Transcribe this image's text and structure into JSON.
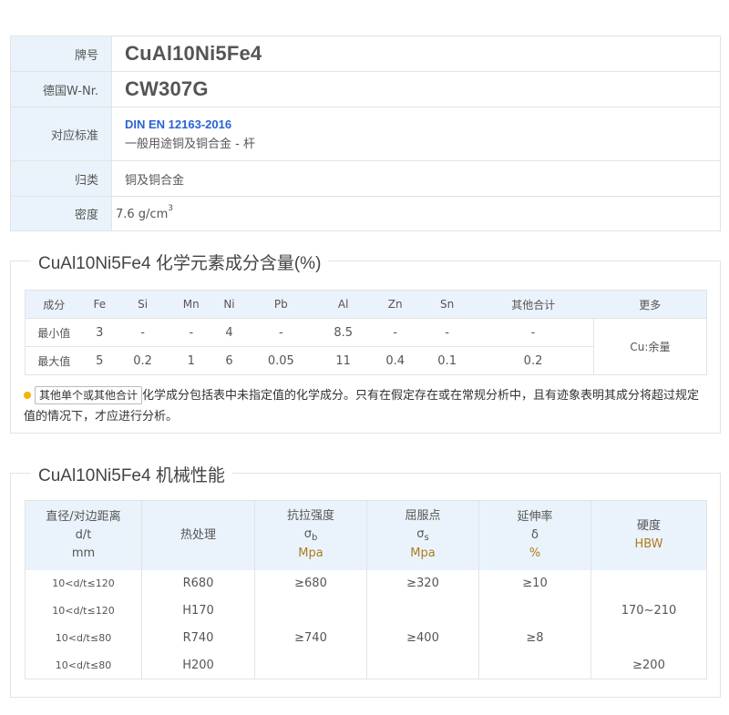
{
  "info": {
    "grade_label": "牌号",
    "grade_value": "CuAl10Ni5Fe4",
    "wnr_label": "德国W-Nr.",
    "wnr_value": "CW307G",
    "standard_label": "对应标准",
    "standard_link": "DIN EN 12163-2016",
    "standard_desc": "一般用途铜及铜合金 - 杆",
    "category_label": "归类",
    "category_value": "铜及铜合金",
    "density_label": "密度",
    "density_value": "7.6 g/cm",
    "density_exp": "3"
  },
  "chemistry": {
    "title": "CuAl10Ni5Fe4 化学元素成分含量(%)",
    "headers": [
      "成分",
      "Fe",
      "Si",
      "Mn",
      "Ni",
      "Pb",
      "Al",
      "Zn",
      "Sn",
      "其他合计",
      "更多"
    ],
    "rows": [
      {
        "label": "最小值",
        "values": [
          "3",
          "-",
          "-",
          "4",
          "-",
          "8.5",
          "-",
          "-",
          "-"
        ]
      },
      {
        "label": "最大值",
        "values": [
          "5",
          "0.2",
          "1",
          "6",
          "0.05",
          "11",
          "0.4",
          "0.1",
          "0.2"
        ]
      }
    ],
    "more_value": "Cu:余量",
    "note_tag": "其他单个或其他合计",
    "note_text": "化学成分包括表中未指定值的化学成分。只有在假定存在或在常规分析中，且有迹象表明其成分将超过规定值的情况下，才应进行分析。"
  },
  "mechanical": {
    "title": "CuAl10Ni5Fe4 机械性能",
    "headers": {
      "dim": [
        "直径/对边距离",
        "d/t",
        "mm"
      ],
      "heat": "热处理",
      "tensile": {
        "name": "抗拉强度",
        "sym": "σ",
        "sub": "b",
        "unit": "Mpa"
      },
      "yield": {
        "name": "屈服点",
        "sym": "σ",
        "sub": "s",
        "unit": "Mpa"
      },
      "elong": {
        "name": "延伸率",
        "sym": "δ",
        "unit": "%"
      },
      "hard": {
        "name": "硬度",
        "unit": "HBW"
      }
    },
    "rows": [
      {
        "dim": "10<d/t≤120",
        "heat": "R680",
        "tensile": "≥680",
        "yield": "≥320",
        "elong": "≥10",
        "hard": ""
      },
      {
        "dim": "10<d/t≤120",
        "heat": "H170",
        "tensile": "",
        "yield": "",
        "elong": "",
        "hard": "170~210"
      },
      {
        "dim": "10<d/t≤80",
        "heat": "R740",
        "tensile": "≥740",
        "yield": "≥400",
        "elong": "≥8",
        "hard": ""
      },
      {
        "dim": "10<d/t≤80",
        "heat": "H200",
        "tensile": "",
        "yield": "",
        "elong": "",
        "hard": "≥200"
      }
    ]
  },
  "colors": {
    "header_bg": "#eaf3fb",
    "link": "#2b62d6",
    "unit": "#b07b1e",
    "bullet": "#f6b400"
  }
}
